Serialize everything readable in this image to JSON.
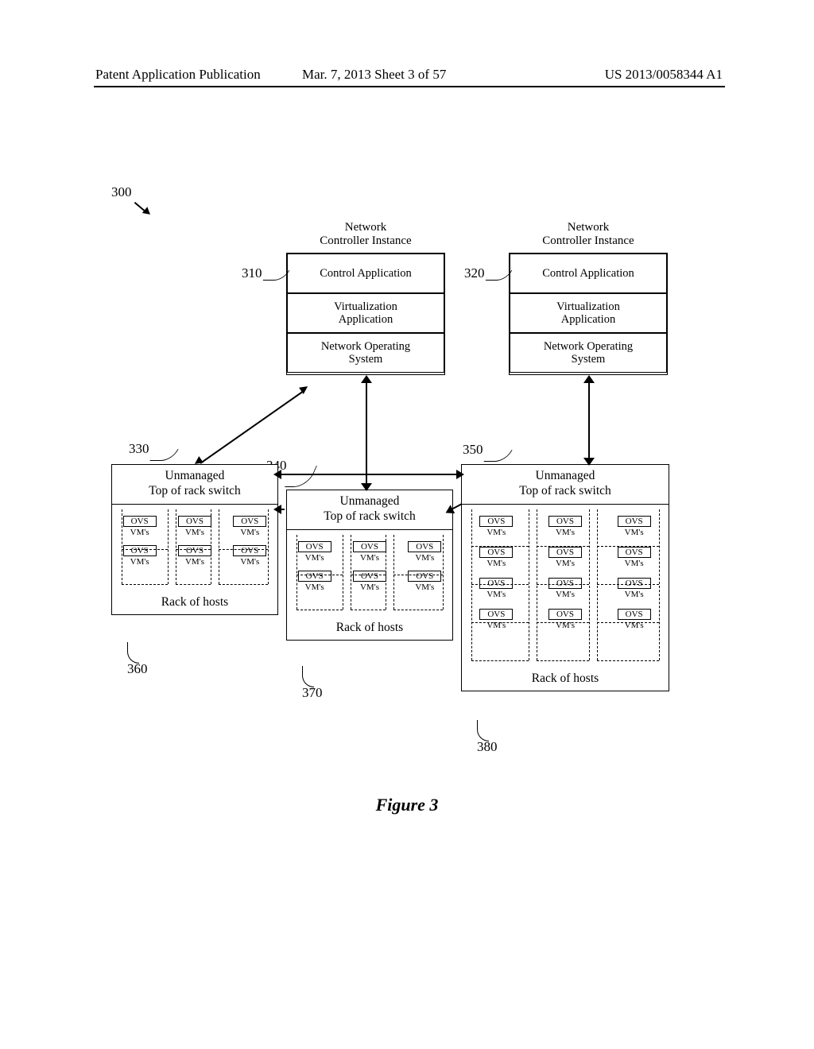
{
  "header": {
    "left": "Patent Application Publication",
    "center": "Mar. 7, 2013  Sheet 3 of 57",
    "right": "US 2013/0058344 A1"
  },
  "refs": {
    "r300": "300",
    "r310": "310",
    "r320": "320",
    "r330": "330",
    "r340": "340",
    "r350": "350",
    "r360": "360",
    "r370": "370",
    "r380": "380"
  },
  "controller": {
    "title": "Network\nController Instance",
    "row1": "Control Application",
    "row2": "Virtualization\nApplication",
    "row3": "Network Operating\nSystem"
  },
  "rack": {
    "tor_a": "Unmanaged",
    "tor_b": "Top of rack switch",
    "ovs": "OVS",
    "vms": "VM's",
    "label": "Rack of hosts"
  },
  "figure": "Figure 3"
}
